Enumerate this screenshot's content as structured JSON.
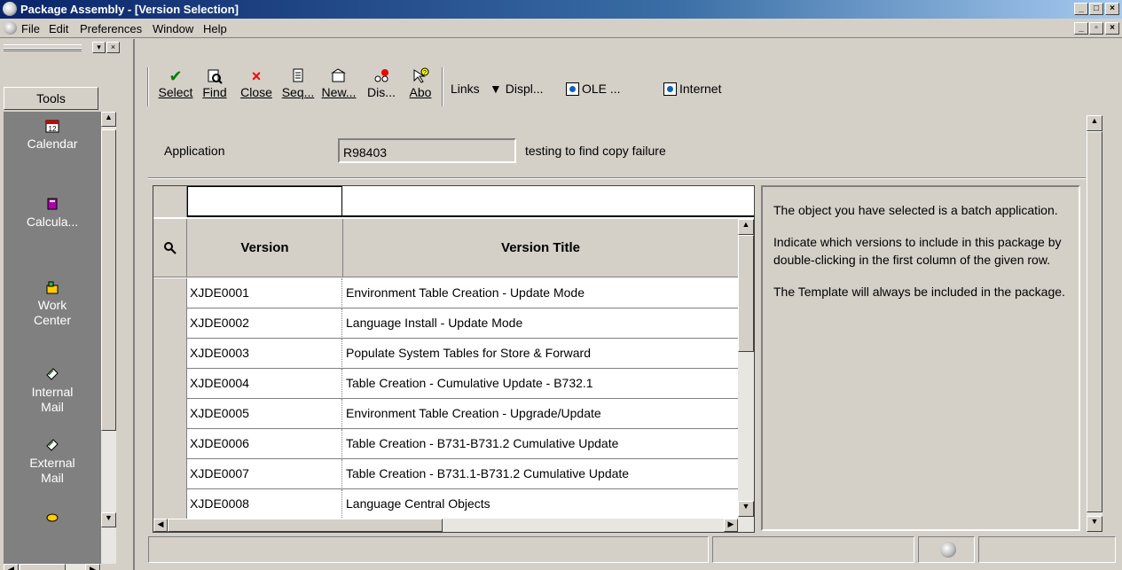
{
  "window": {
    "title": "Package Assembly - [Version Selection]"
  },
  "menu": {
    "items": [
      "File",
      "Edit",
      "Preferences",
      "Window",
      "Help"
    ]
  },
  "tools": {
    "header": "Tools",
    "items": [
      {
        "icon": "calendar-icon",
        "label": "Calendar"
      },
      {
        "icon": "calculator-icon",
        "label": "Calcula..."
      },
      {
        "icon": "work-center-icon",
        "label": "Work Center"
      },
      {
        "icon": "mail-icon",
        "label": "Internal Mail"
      },
      {
        "icon": "mail-icon",
        "label": "External Mail"
      }
    ]
  },
  "toolbar": {
    "buttons": [
      {
        "label": "Select",
        "icon": "checkmark-icon",
        "color": "#008000"
      },
      {
        "label": "Find",
        "icon": "find-icon"
      },
      {
        "label": "Close",
        "icon": "close-x-icon",
        "color": "#ff0000"
      },
      {
        "label": "Seq...",
        "icon": "sequence-icon"
      },
      {
        "label": "New...",
        "icon": "new-icon"
      },
      {
        "label": "Dis...",
        "icon": "display-icon"
      },
      {
        "label": "Abo",
        "icon": "about-icon"
      }
    ],
    "links_label": "Links",
    "display_label": "Displ...",
    "ole_label": "OLE ...",
    "internet_label": "Internet"
  },
  "form": {
    "application_label": "Application",
    "application_value": "R98403",
    "application_desc": "testing to find copy failure"
  },
  "grid": {
    "columns": [
      "Version",
      "Version Title"
    ],
    "rows": [
      {
        "version": "XJDE0001",
        "title": "Environment Table Creation - Update Mode"
      },
      {
        "version": "XJDE0002",
        "title": "Language Install - Update Mode"
      },
      {
        "version": "XJDE0003",
        "title": "Populate System Tables for Store & Forward"
      },
      {
        "version": "XJDE0004",
        "title": "Table Creation - Cumulative Update - B732.1"
      },
      {
        "version": "XJDE0005",
        "title": "Environment Table Creation - Upgrade/Update"
      },
      {
        "version": "XJDE0006",
        "title": "Table Creation - B731-B731.2 Cumulative Update"
      },
      {
        "version": "XJDE0007",
        "title": "Table Creation - B731.1-B731.2 Cumulative Update"
      },
      {
        "version": "XJDE0008",
        "title": "Language Central Objects"
      }
    ]
  },
  "info": {
    "p1": "The object you have selected is a batch application.",
    "p2": "Indicate which versions to include in this package by double-clicking in the first column of the given row.",
    "p3": "The Template will always be included in the package."
  },
  "colors": {
    "titlebar_start": "#0a246a",
    "face": "#d4d0c8",
    "tools_bg": "#808080"
  }
}
